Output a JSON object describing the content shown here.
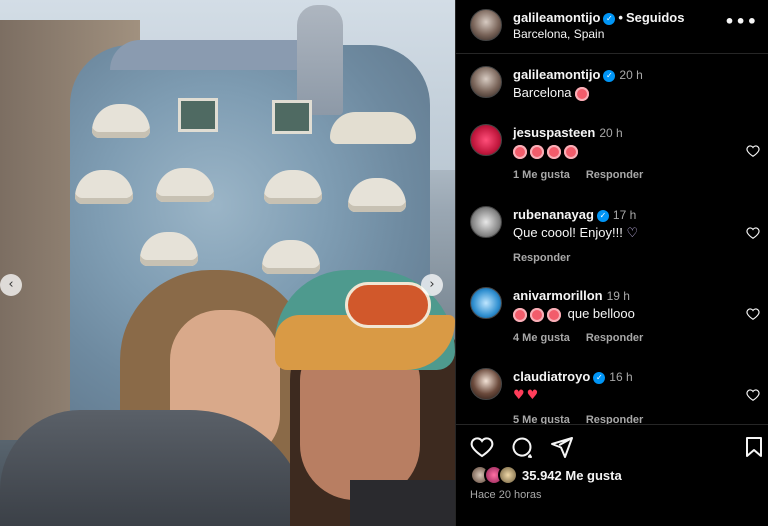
{
  "post": {
    "author": "galileamontijo",
    "follow_state": "Seguidos",
    "location": "Barcelona, Spain",
    "more_label": "•••"
  },
  "caption": {
    "user": "galileamontijo",
    "time": "20 h",
    "text": "Barcelona"
  },
  "comments": [
    {
      "user": "jesuspasteen",
      "time": "20 h",
      "verified": false,
      "likes": "1 Me gusta",
      "reply": "Responder"
    },
    {
      "user": "rubenanayag",
      "time": "17 h",
      "verified": true,
      "text": "Que coool! Enjoy!!!",
      "reply": "Responder"
    },
    {
      "user": "anivarmorillon",
      "time": "19 h",
      "verified": false,
      "text": "que bellooo",
      "likes": "4 Me gusta",
      "reply": "Responder"
    },
    {
      "user": "claudiatroyo",
      "time": "16 h",
      "verified": true,
      "likes": "5 Me gusta",
      "reply": "Responder"
    }
  ],
  "footer": {
    "likes_count": "35.942 Me gusta",
    "posted_ago": "Hace 20 horas"
  },
  "icons": {
    "prev": "‹",
    "next": "›",
    "verified": "✓"
  },
  "colors": {
    "accent": "#0095f6",
    "background": "#000000",
    "muted_text": "#a8a8a8"
  }
}
